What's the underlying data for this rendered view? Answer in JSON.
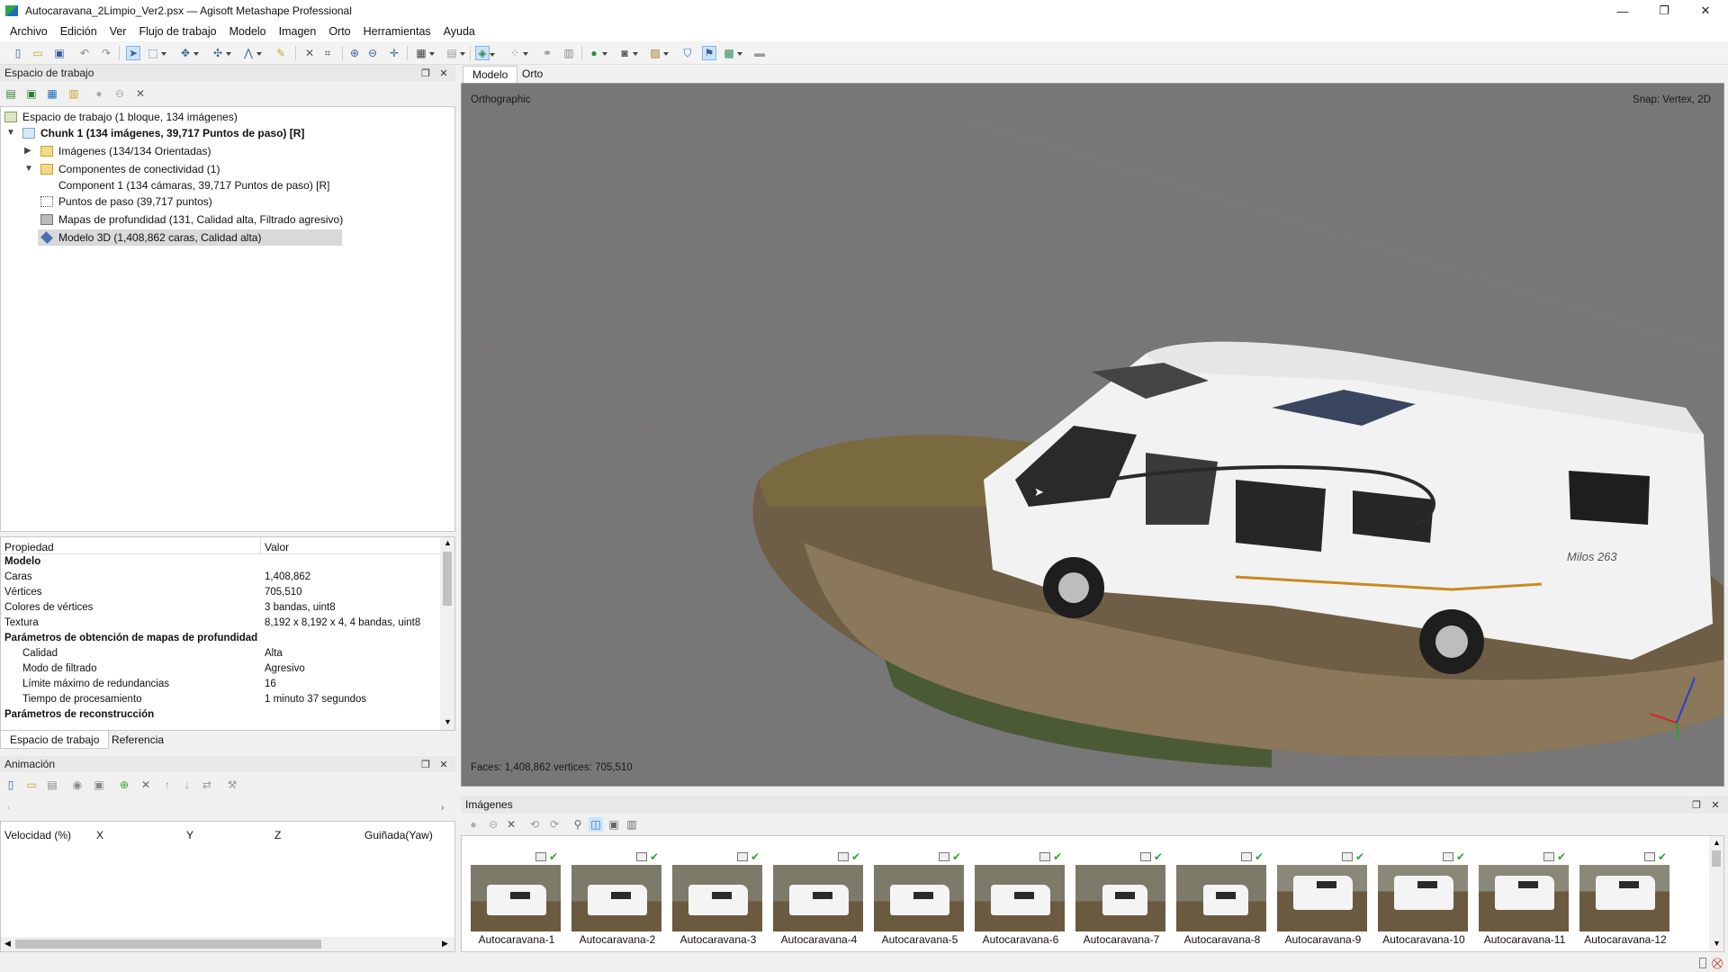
{
  "window": {
    "title": "Autocaravana_2Limpio_Ver2.psx — Agisoft Metashape Professional",
    "controls": [
      "—",
      "❐",
      "✕"
    ]
  },
  "menu": [
    "Archivo",
    "Edición",
    "Ver",
    "Flujo de trabajo",
    "Modelo",
    "Imagen",
    "Orto",
    "Herramientas",
    "Ayuda"
  ],
  "workspace": {
    "panel_title": "Espacio de trabajo",
    "root": "Espacio de trabajo (1 bloque, 134 imágenes)",
    "chunk": "Chunk 1 (134 imágenes, 39,717 Puntos de paso) [R]",
    "images": "Imágenes (134/134 Orientadas)",
    "components": "Componentes de conectividad (1)",
    "component1": "Component 1 (134 cámaras, 39,717 Puntos de paso) [R]",
    "tie_points": "Puntos de paso (39,717 puntos)",
    "depth_maps": "Mapas de profundidad (131, Calidad alta, Filtrado agresivo)",
    "model": "Modelo 3D (1,408,862 caras, Calidad alta)"
  },
  "properties": {
    "col_property": "Propiedad",
    "col_value": "Valor",
    "rows": [
      {
        "k": "Modelo",
        "v": "",
        "bold": true,
        "indent": false
      },
      {
        "k": "Caras",
        "v": "1,408,862",
        "bold": false,
        "indent": false
      },
      {
        "k": "Vértices",
        "v": "705,510",
        "bold": false,
        "indent": false
      },
      {
        "k": "Colores de vértices",
        "v": "3 bandas, uint8",
        "bold": false,
        "indent": false
      },
      {
        "k": "Textura",
        "v": "8,192 x 8,192 x 4, 4 bandas, uint8",
        "bold": false,
        "indent": false
      },
      {
        "k": "Parámetros de obtención de mapas de profundidad",
        "v": "",
        "bold": true,
        "indent": false
      },
      {
        "k": "Calidad",
        "v": "Alta",
        "bold": false,
        "indent": true
      },
      {
        "k": "Modo de filtrado",
        "v": "Agresivo",
        "bold": false,
        "indent": true
      },
      {
        "k": "Límite máximo de redundancias",
        "v": "16",
        "bold": false,
        "indent": true
      },
      {
        "k": "Tiempo de procesamiento",
        "v": "1 minuto 37 segundos",
        "bold": false,
        "indent": true
      },
      {
        "k": "Parámetros de reconstrucción",
        "v": "",
        "bold": true,
        "indent": false
      }
    ]
  },
  "ws_tabs": [
    "Espacio de trabajo",
    "Referencia"
  ],
  "animation": {
    "panel_title": "Animación",
    "columns": [
      "Velocidad (%)",
      "X",
      "Y",
      "Z",
      "Guiñada(Yaw)"
    ]
  },
  "view_tabs": [
    "Modelo",
    "Orto"
  ],
  "viewport": {
    "projection": "Orthographic",
    "snap": "Snap: Vertex, 2D",
    "stats": "Faces: 1,408,862 vertices: 705,510",
    "van_brand": "Milos 263"
  },
  "images_panel": {
    "title": "Imágenes",
    "items": [
      "Autocaravana-1",
      "Autocaravana-2",
      "Autocaravana-3",
      "Autocaravana-4",
      "Autocaravana-5",
      "Autocaravana-6",
      "Autocaravana-7",
      "Autocaravana-8",
      "Autocaravana-9",
      "Autocaravana-10",
      "Autocaravana-11",
      "Autocaravana-12"
    ]
  },
  "colors": {
    "viewport_bg": "#777777",
    "selection": "#d9d9d9",
    "check": "#2fa52f"
  }
}
